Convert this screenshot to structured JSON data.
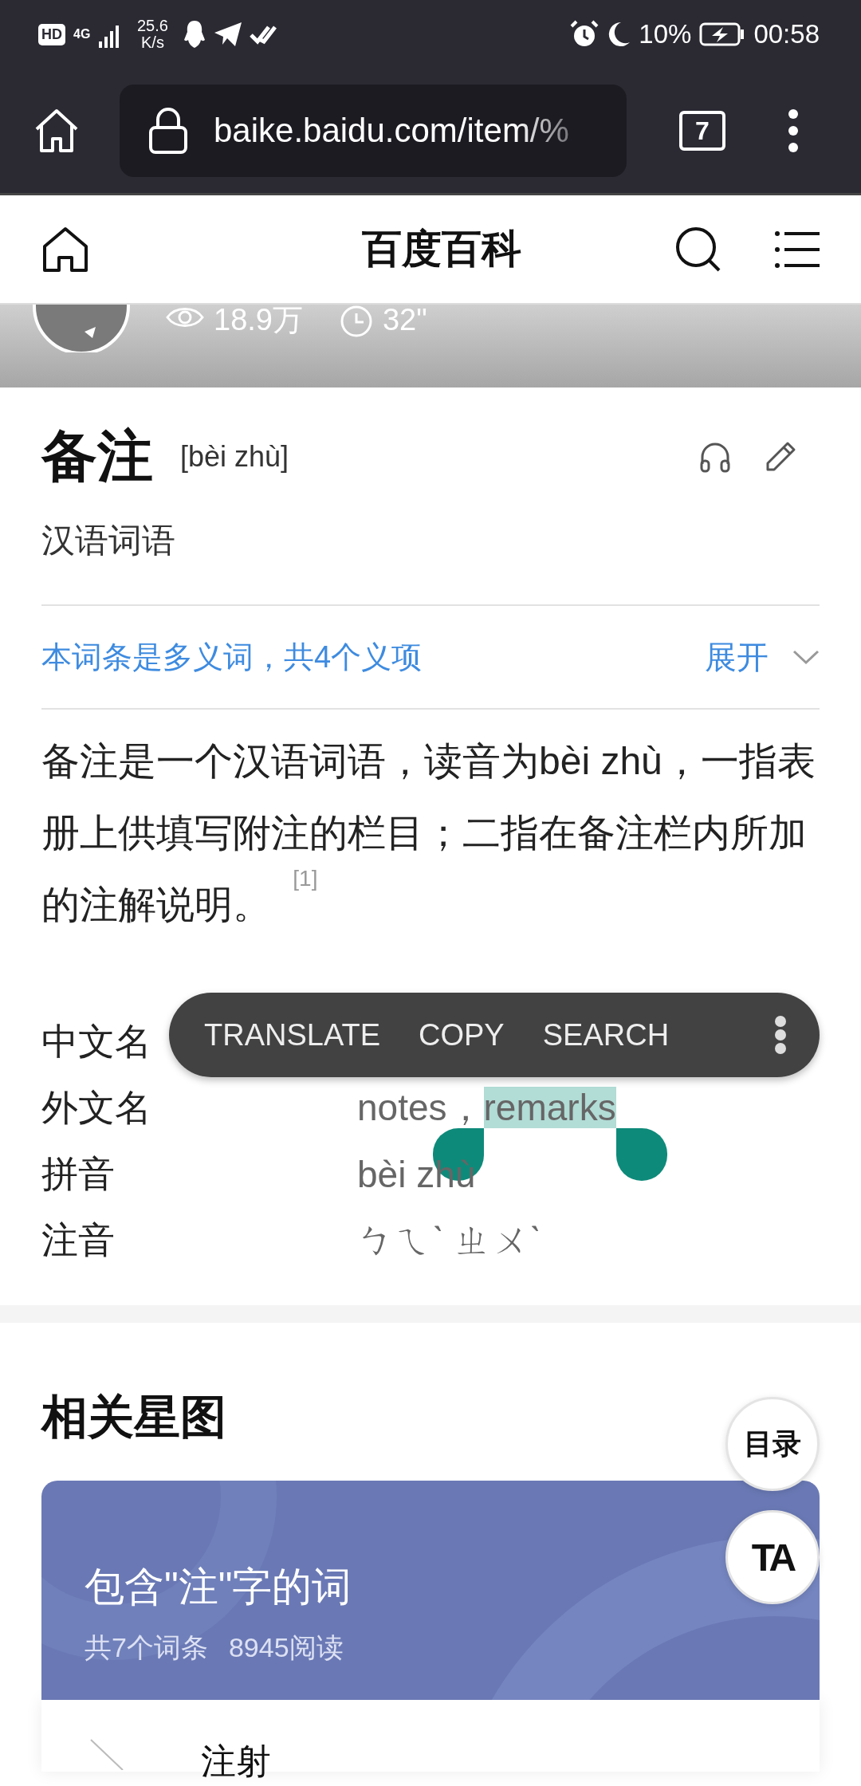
{
  "status_bar": {
    "hd": "HD",
    "network": "4G",
    "speed": "25.6",
    "speed_unit": "K/s",
    "battery": "10%",
    "time": "00:58"
  },
  "browser": {
    "url": "baike.baidu.com/item/%",
    "tab_count": "7"
  },
  "site_header": {
    "title": "百度百科"
  },
  "hero": {
    "views": "18.9万",
    "duration": "32\""
  },
  "entry": {
    "title": "备注",
    "pinyin": "[bèi zhù]",
    "category": "汉语词语",
    "polysemy": {
      "text": "本词条是多义词，共4个义项",
      "expand": "展开"
    },
    "summary": "备注是一个汉语词语，读音为bèi zhù，一指表册上供填写附注的栏目；二指在备注栏内所加的注解说明。 $^{[1]}$"
  },
  "info_table": [
    {
      "label": "中文名"
    },
    {
      "label": "外文名",
      "segments": [
        {
          "text": "notes，",
          "selected": false
        },
        {
          "text": "remarks",
          "selected": true
        }
      ]
    },
    {
      "label": "拼音",
      "segments": [
        {
          "text": "bèi zhù",
          "selected": false
        }
      ]
    },
    {
      "label": "注音",
      "segments": [
        {
          "text": "ㄅㄟˋ ㄓㄨˋ",
          "selected": false
        }
      ]
    }
  ],
  "text_selection_menu": {
    "actions": [
      "TRANSLATE",
      "COPY",
      "SEARCH"
    ]
  },
  "related": {
    "title": "相关星图",
    "card": {
      "title": "包含\"注\"字的词",
      "count": "共7个词条",
      "reads": "8945阅读"
    },
    "items": [
      {
        "name": "注射"
      }
    ]
  },
  "floating_buttons": [
    {
      "label": "目录",
      "kind": "text"
    },
    {
      "label": "TA",
      "kind": "logo"
    }
  ]
}
